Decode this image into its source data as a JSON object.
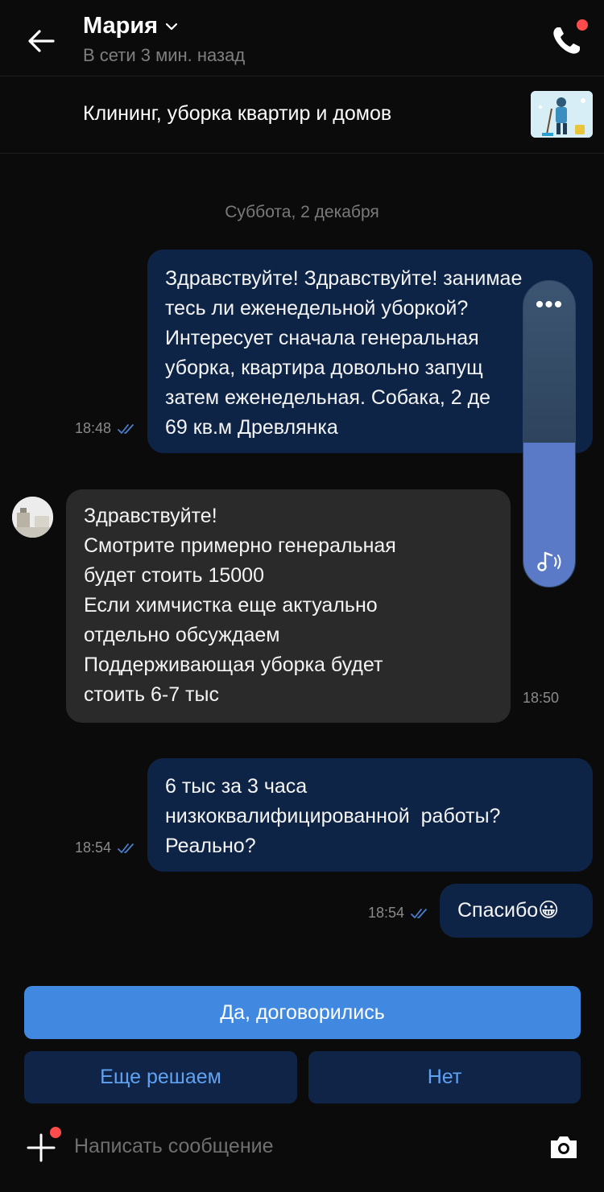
{
  "header": {
    "contact_name": "Мария",
    "status": "В сети 3 мин. назад",
    "icons": [
      "back-arrow-icon",
      "chevron-down-icon",
      "phone-icon"
    ]
  },
  "ad": {
    "title": "Клининг, уборка квартир и домов"
  },
  "date_separator": "Суббота, 2 декабря",
  "messages": [
    {
      "direction": "out",
      "lines": [
        "Здравствуйте! Здравствуйте! занимае",
        "тесь ли еженедельной уборкой?",
        "Интересует сначала генеральная",
        "уборка, квартира довольно запущ",
        "затем еженедельная. Собака, 2 де",
        "69 кв.м Древлянка"
      ],
      "time": "18:48"
    },
    {
      "direction": "in",
      "lines": [
        "Здравствуйте!",
        "Смотрите примерно генеральная",
        "будет стоить 15000",
        "Если химчистка еще актуально",
        "отдельно обсуждаем",
        "Поддерживающая уборка будет",
        "стоить 6-7 тыс"
      ],
      "time": "18:50"
    },
    {
      "direction": "out",
      "lines": [
        "6 тыс за 3 часа",
        "низкоквалифицированной  работы?",
        "Реально?"
      ],
      "time": "18:54"
    },
    {
      "direction": "out",
      "text": "Спасибо😀",
      "time": "18:54"
    }
  ],
  "volume_overlay": {
    "level_fraction": 0.47,
    "menu_label": "•••"
  },
  "quick_replies": {
    "primary": "Да, договорились",
    "secondary_1": "Еще решаем",
    "secondary_2": "Нет"
  },
  "composer": {
    "placeholder": "Написать сообщение"
  },
  "colors": {
    "background": "#0b0b0b",
    "outgoing_bubble": "#0e2446",
    "incoming_bubble": "#2a2a2a",
    "primary_button": "#4189e0",
    "secondary_button": "#0f2447",
    "secondary_text": "#5fa2f1",
    "notification_dot": "#ff4b4b"
  }
}
